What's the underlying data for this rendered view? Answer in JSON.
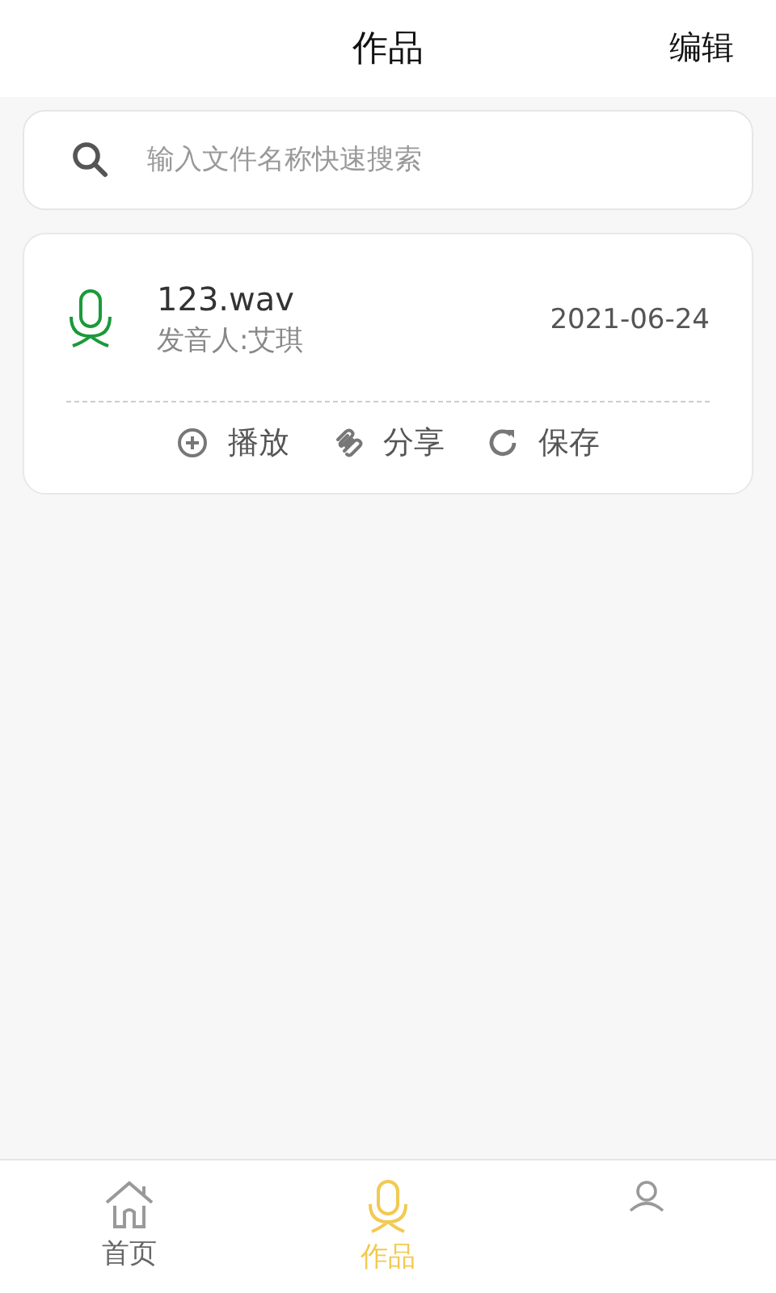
{
  "header": {
    "title": "作品",
    "action": "编辑"
  },
  "search": {
    "placeholder": "输入文件名称快速搜索"
  },
  "works": [
    {
      "filename": "123.wav",
      "speaker": "发音人:艾琪",
      "date": "2021-06-24",
      "actions": [
        {
          "kind": "play",
          "label": "播放"
        },
        {
          "kind": "share",
          "label": "分享"
        },
        {
          "kind": "save",
          "label": "保存"
        }
      ]
    }
  ],
  "tabs": [
    {
      "kind": "home",
      "label": "首页",
      "selected": false
    },
    {
      "kind": "mic",
      "label": "作品",
      "selected": true
    },
    {
      "kind": "person",
      "selected": false
    }
  ]
}
